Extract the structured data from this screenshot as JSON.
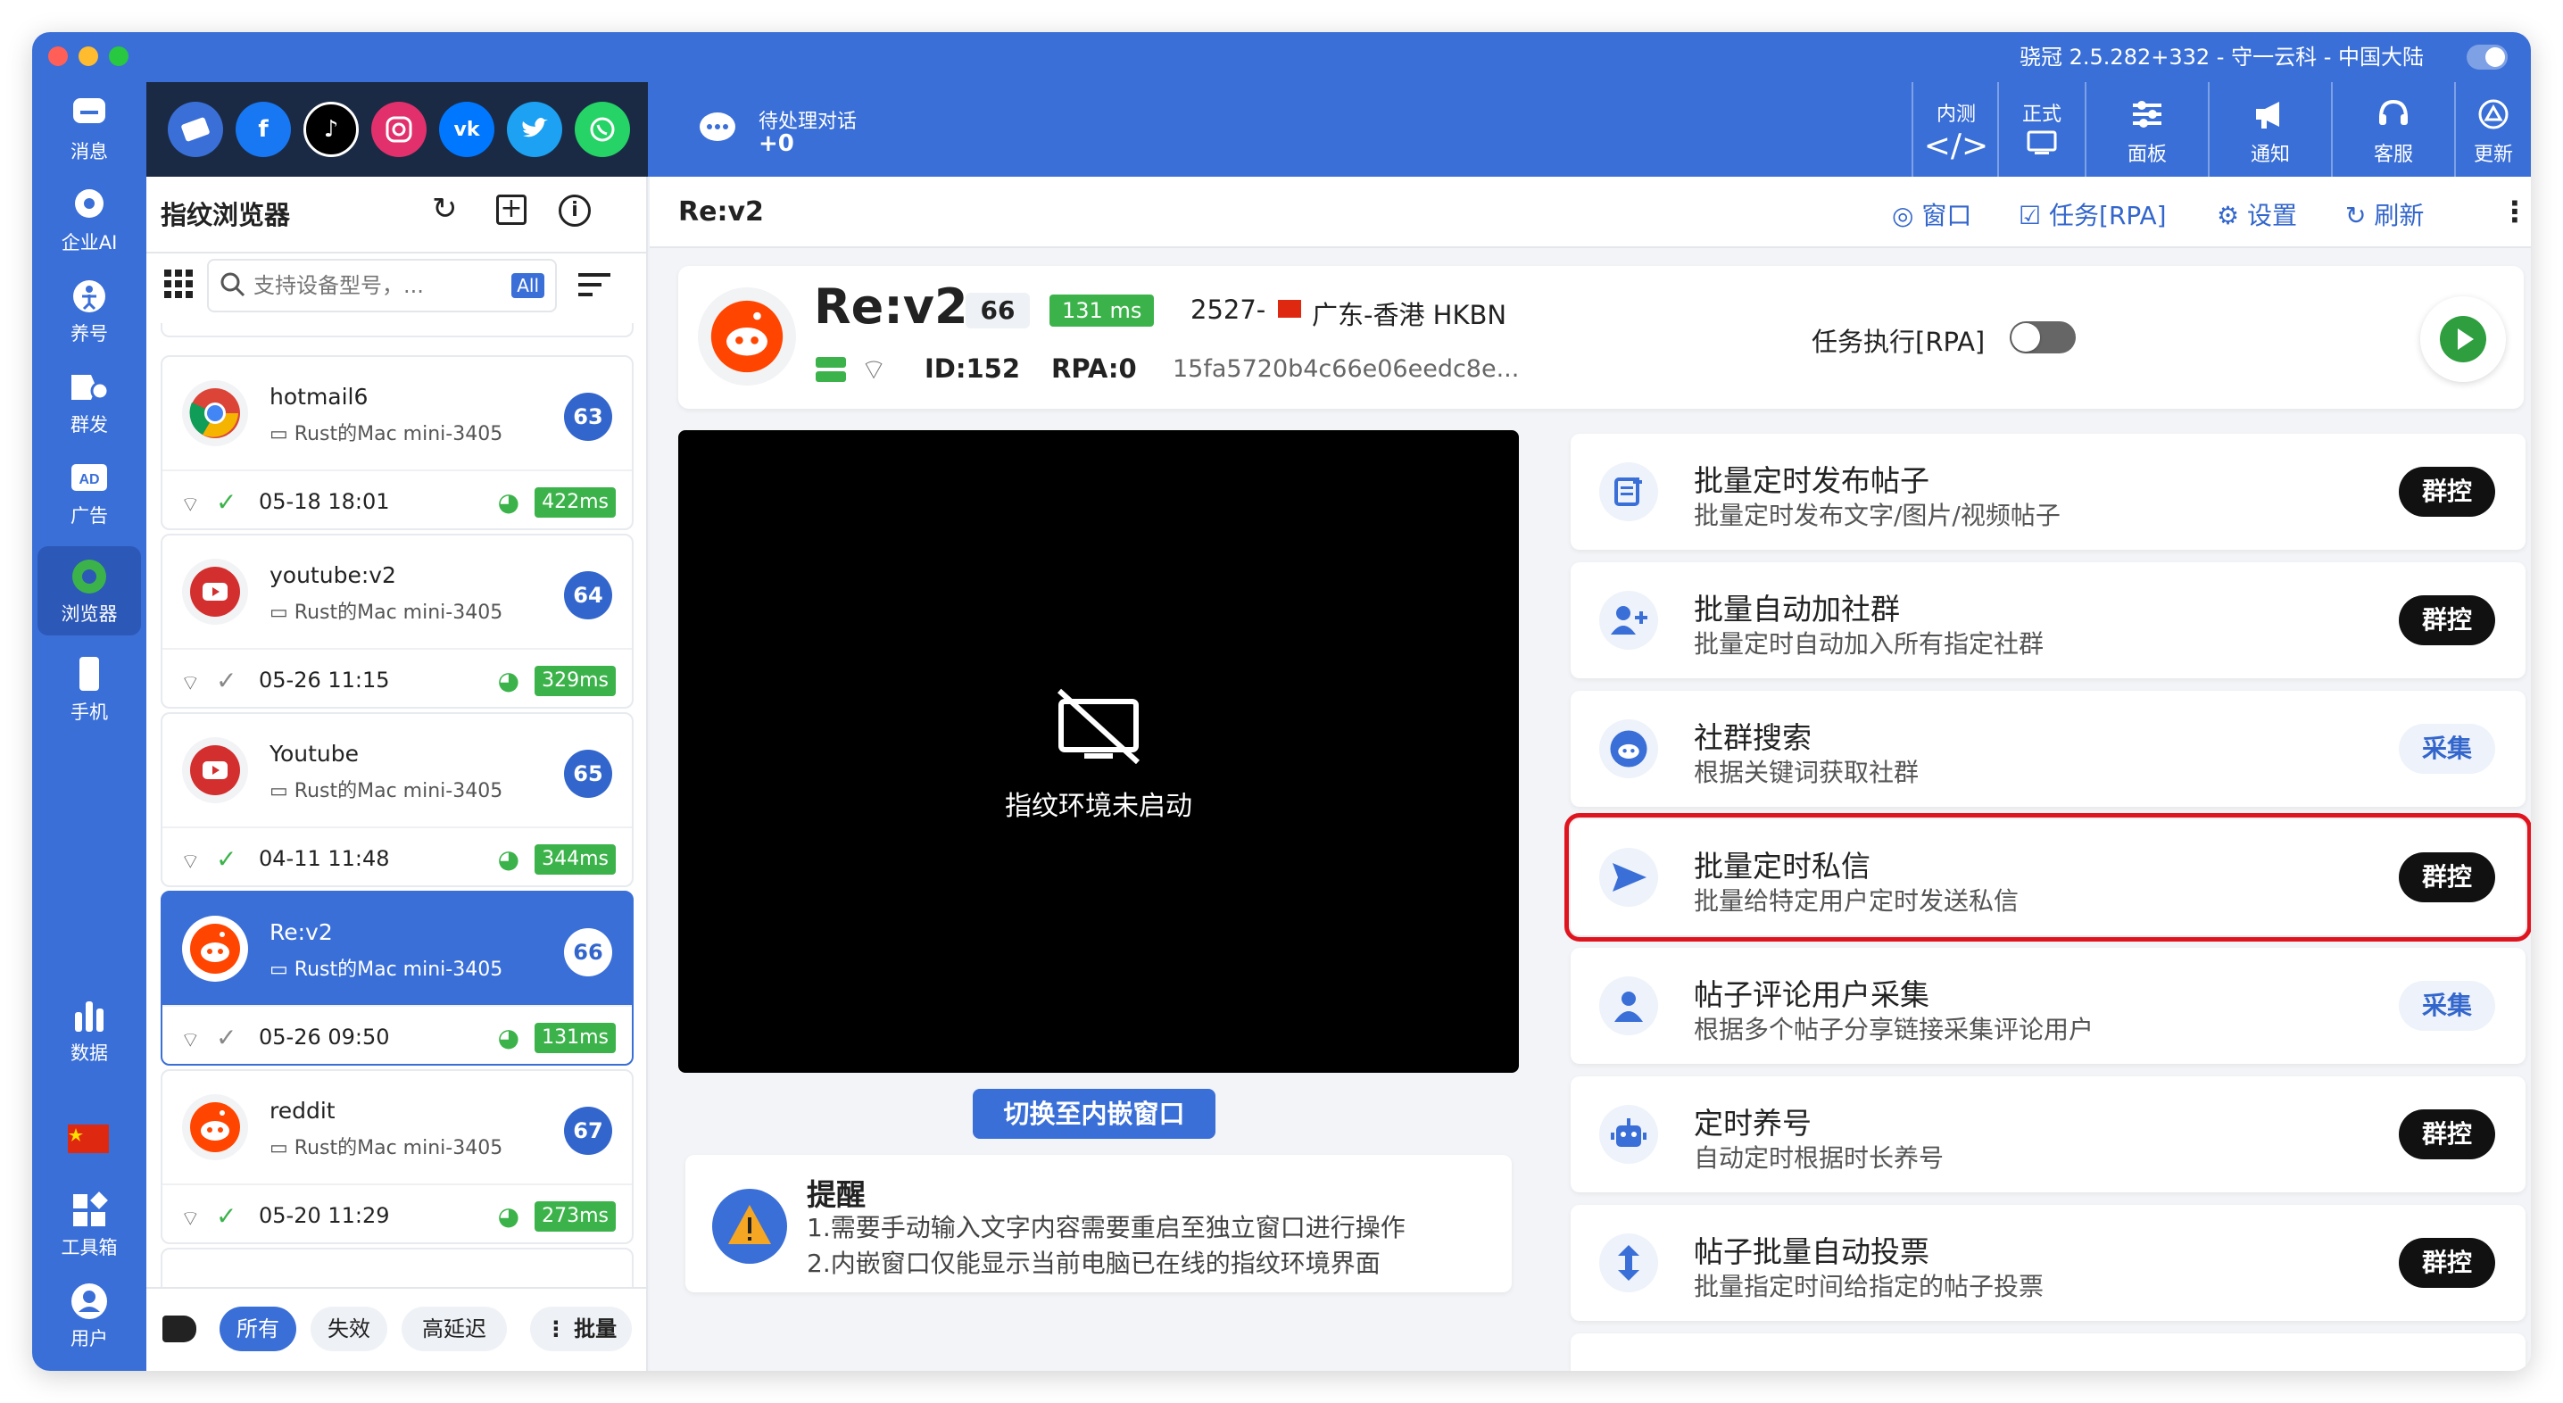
{
  "window": {
    "title": "骁冠 2.5.282+332 - 守一云科 - 中国大陆"
  },
  "leftnav": [
    {
      "label": "消息",
      "icon": "message-icon"
    },
    {
      "label": "企业AI",
      "icon": "ai-icon"
    },
    {
      "label": "养号",
      "icon": "nurture-icon"
    },
    {
      "label": "群发",
      "icon": "broadcast-icon"
    },
    {
      "label": "广告",
      "icon": "ad-icon"
    },
    {
      "label": "浏览器",
      "icon": "browser-icon"
    },
    {
      "label": "手机",
      "icon": "phone-icon"
    },
    {
      "label": "数据",
      "icon": "data-icon"
    },
    {
      "label": "工具箱",
      "icon": "toolbox-icon"
    },
    {
      "label": "用户",
      "icon": "user-icon"
    }
  ],
  "platforms": [
    "profile-icon",
    "facebook-icon",
    "tiktok-icon",
    "instagram-icon",
    "vk-icon",
    "twitter-icon",
    "whatsapp-icon"
  ],
  "topbar": {
    "pending_label": "待处理对话",
    "pending_count": "+0",
    "buttons": [
      {
        "label": "内测",
        "icon": "code-icon"
      },
      {
        "label": "正式",
        "icon": "release-icon"
      },
      {
        "label": "面板",
        "icon": "panel-icon"
      },
      {
        "label": "通知",
        "icon": "notify-icon"
      },
      {
        "label": "客服",
        "icon": "support-icon"
      },
      {
        "label": "更新",
        "icon": "update-icon"
      }
    ]
  },
  "sidebar": {
    "title": "指纹浏览器",
    "search_placeholder": "支持设备型号，...",
    "search_badge": "All",
    "cards": [
      {
        "name": "hotmail6",
        "device": "Rust的Mac mini-3405",
        "num": "63",
        "date": "05-18 18:01",
        "ms": "422ms",
        "avatar": "chrome"
      },
      {
        "name": "youtube:v2",
        "device": "Rust的Mac mini-3405",
        "num": "64",
        "date": "05-26 11:15",
        "ms": "329ms",
        "avatar": "youtube"
      },
      {
        "name": "Youtube",
        "device": "Rust的Mac mini-3405",
        "num": "65",
        "date": "04-11 11:48",
        "ms": "344ms",
        "avatar": "youtube"
      },
      {
        "name": "Re:v2",
        "device": "Rust的Mac mini-3405",
        "num": "66",
        "date": "05-26 09:50",
        "ms": "131ms",
        "avatar": "reddit"
      },
      {
        "name": "reddit",
        "device": "Rust的Mac mini-3405",
        "num": "67",
        "date": "05-20 11:29",
        "ms": "273ms",
        "avatar": "reddit"
      }
    ],
    "filters": [
      "所有",
      "失效",
      "高延迟"
    ],
    "batch_label": "批量"
  },
  "main": {
    "header_title": "Re:v2",
    "header_actions": [
      "窗口",
      "任务[RPA]",
      "设置",
      "刷新"
    ],
    "profile": {
      "name": "Re:v2",
      "num": "66",
      "ms": "131 ms",
      "location": "2527-",
      "region": "广东-香港 HKBN",
      "id": "ID:152",
      "rpa": "RPA:0",
      "hash": "15fa5720b4c66e06eedc8e...",
      "rpa_toggle_label": "任务执行[RPA]"
    },
    "video_text": "指纹环境未启动",
    "switch_button": "切换至内嵌窗口",
    "reminder": {
      "title": "提醒",
      "line1": "1.需要手动输入文字内容需要重启至独立窗口进行操作",
      "line2": "2.内嵌窗口仅能显示当前电脑已在线的指纹环境界面"
    },
    "tasks": [
      {
        "title": "批量定时发布帖子",
        "desc": "批量定时发布文字/图片/视频帖子",
        "btn": "群控",
        "icon": "post-icon"
      },
      {
        "title": "批量自动加社群",
        "desc": "批量定时自动加入所有指定社群",
        "btn": "群控",
        "icon": "add-group-icon"
      },
      {
        "title": "社群搜索",
        "desc": "根据关键词获取社群",
        "btn": "采集",
        "icon": "reddit-icon"
      },
      {
        "title": "批量定时私信",
        "desc": "批量给特定用户定时发送私信",
        "btn": "群控",
        "icon": "send-icon"
      },
      {
        "title": "帖子评论用户采集",
        "desc": "根据多个帖子分享链接采集评论用户",
        "btn": "采集",
        "icon": "person-icon"
      },
      {
        "title": "定时养号",
        "desc": "自动定时根据时长养号",
        "btn": "群控",
        "icon": "robot-icon"
      },
      {
        "title": "帖子批量自动投票",
        "desc": "批量指定时间给指定的帖子投票",
        "btn": "群控",
        "icon": "vote-icon"
      }
    ]
  },
  "colors": {
    "accent": "#3a6fd8",
    "success": "#3cb34a",
    "highlight": "#e0141e",
    "reddit": "#ff4500"
  }
}
